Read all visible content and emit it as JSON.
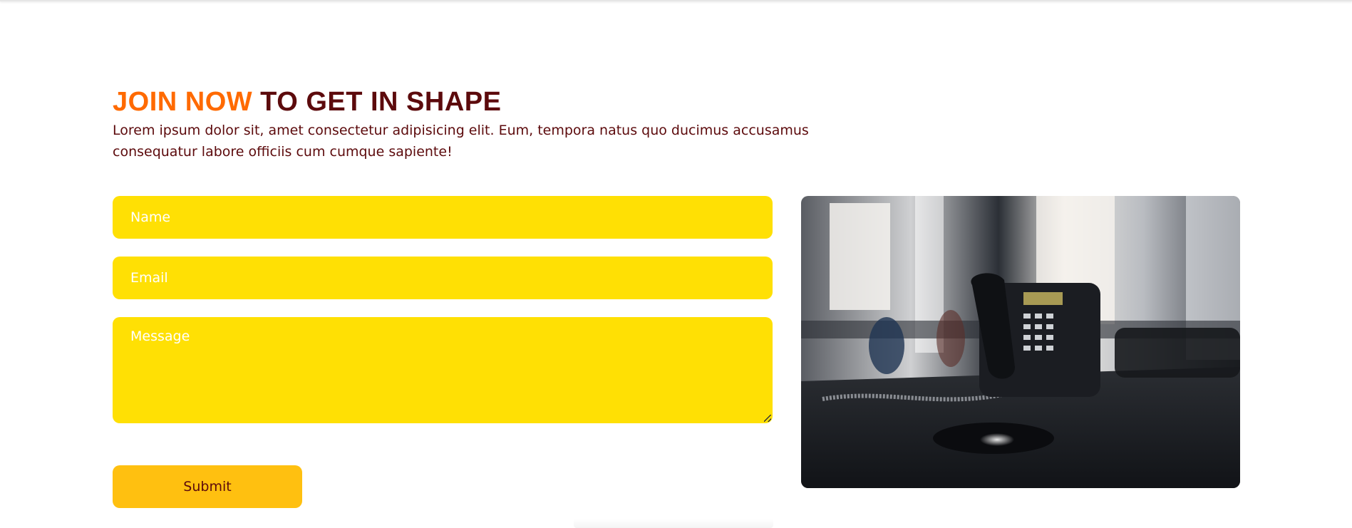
{
  "heading": {
    "accent": "JOIN NOW",
    "rest": " TO GET IN SHAPE"
  },
  "intro": "Lorem ipsum dolor sit, amet consectetur adipisicing elit. Eum, tempora natus quo ducimus accusamus consequatur labore officiis cum cumque sapiente!",
  "form": {
    "name_placeholder": "Name",
    "email_placeholder": "Email",
    "message_placeholder": "Message",
    "submit_label": "Submit"
  },
  "colors": {
    "accent": "#ff6a00",
    "heading": "#5c0a0c",
    "field_bg": "#ffe004",
    "button_bg": "#ffc010"
  },
  "photo": {
    "icon": "office-desk-phone-photo"
  }
}
